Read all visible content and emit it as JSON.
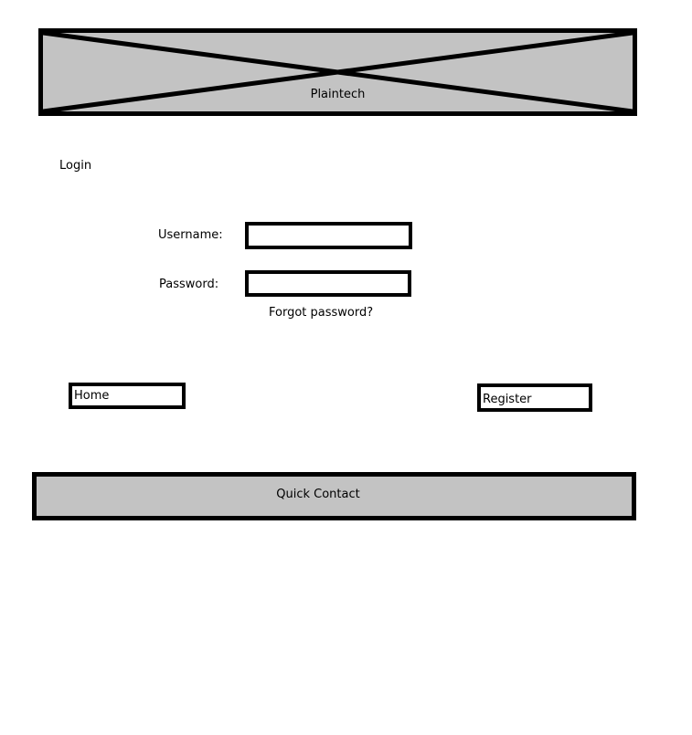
{
  "banner": {
    "title": "Plaintech",
    "image_placeholder_icon": "image-placeholder-icon"
  },
  "page": {
    "heading": "Login"
  },
  "form": {
    "username_label": "Username:",
    "username_value": "",
    "password_label": "Password:",
    "password_value": "",
    "forgot_password": "Forgot password?"
  },
  "nav": {
    "home_label": "Home",
    "register_label": "Register"
  },
  "footer": {
    "quick_contact_label": "Quick Contact"
  },
  "colors": {
    "placeholder_fill": "#c3c3c3",
    "border": "#000000",
    "background": "#ffffff"
  }
}
